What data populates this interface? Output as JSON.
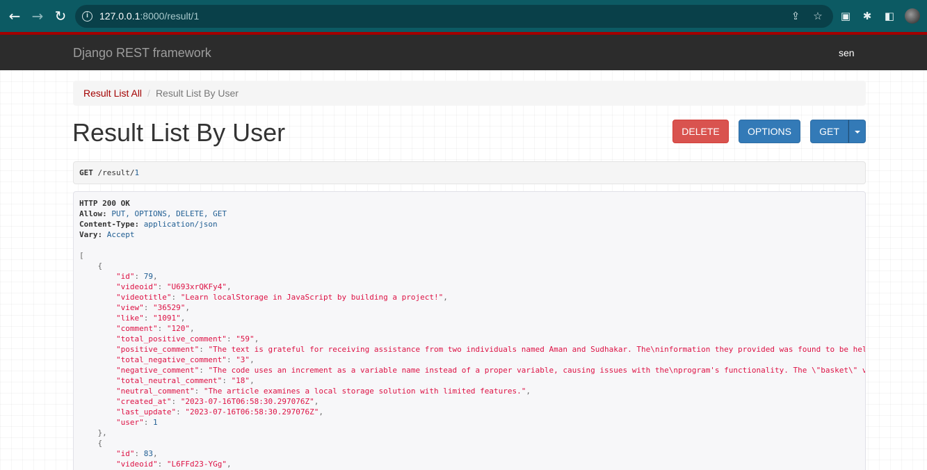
{
  "browser": {
    "url_host": "127.0.0.1",
    "url_path": ":8000/result/1"
  },
  "navbar": {
    "brand": "Django REST framework",
    "user": "sen"
  },
  "breadcrumb": {
    "link": "Result List All",
    "separator": "/",
    "active": "Result List By User"
  },
  "page": {
    "title": "Result List By User"
  },
  "buttons": {
    "delete": "DELETE",
    "options": "OPTIONS",
    "get": "GET"
  },
  "request": {
    "method": "GET",
    "path": "/result/",
    "id": "1"
  },
  "response": {
    "status": "HTTP 200 OK",
    "headers": [
      {
        "key": "Allow:",
        "value": "PUT, OPTIONS, DELETE, GET"
      },
      {
        "key": "Content-Type:",
        "value": "application/json"
      },
      {
        "key": "Vary:",
        "value": "Accept"
      }
    ],
    "records": [
      {
        "fields": [
          {
            "key": "\"id\"",
            "value": "79",
            "type": "num"
          },
          {
            "key": "\"videoid\"",
            "value": "\"U693xrQKFy4\"",
            "type": "str"
          },
          {
            "key": "\"videotitle\"",
            "value": "\"Learn localStorage in JavaScript by building a project!\"",
            "type": "str"
          },
          {
            "key": "\"view\"",
            "value": "\"36529\"",
            "type": "str"
          },
          {
            "key": "\"like\"",
            "value": "\"1091\"",
            "type": "str"
          },
          {
            "key": "\"comment\"",
            "value": "\"120\"",
            "type": "str"
          },
          {
            "key": "\"total_positive_comment\"",
            "value": "\"59\"",
            "type": "str"
          },
          {
            "key": "\"positive_comment\"",
            "value": "\"The text is grateful for receiving assistance from two individuals named Aman and Sudhakar. The\\ninformation they provided was found to be help",
            "type": "str"
          },
          {
            "key": "\"total_negative_comment\"",
            "value": "\"3\"",
            "type": "str"
          },
          {
            "key": "\"negative_comment\"",
            "value": "\"The code uses an increment as a variable name instead of a proper variable, causing issues with the\\nprogram's functionality. The \\\"basket\\\" va",
            "type": "str"
          },
          {
            "key": "\"total_neutral_comment\"",
            "value": "\"18\"",
            "type": "str"
          },
          {
            "key": "\"neutral_comment\"",
            "value": "\"The article examines a local storage solution with limited features.\"",
            "type": "str"
          },
          {
            "key": "\"created_at\"",
            "value": "\"2023-07-16T06:58:30.297076Z\"",
            "type": "str"
          },
          {
            "key": "\"last_update\"",
            "value": "\"2023-07-16T06:58:30.297076Z\"",
            "type": "str"
          },
          {
            "key": "\"user\"",
            "value": "1",
            "type": "num",
            "last": true
          }
        ]
      },
      {
        "fields": [
          {
            "key": "\"id\"",
            "value": "83",
            "type": "num"
          },
          {
            "key": "\"videoid\"",
            "value": "\"L6FFd23-YGg\"",
            "type": "str"
          }
        ]
      }
    ]
  }
}
